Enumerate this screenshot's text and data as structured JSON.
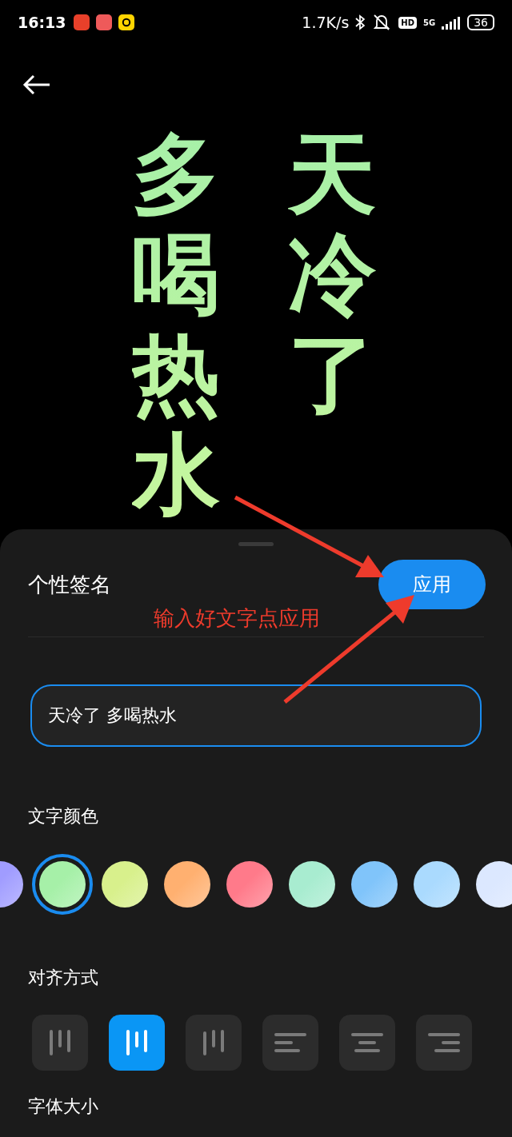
{
  "status_bar": {
    "time": "16:13",
    "speed": "1.7K/s",
    "hd": "HD",
    "network": "5G",
    "battery": "36"
  },
  "signature_preview": {
    "columns": [
      "多喝热水",
      "天冷了"
    ]
  },
  "sheet": {
    "title": "个性签名",
    "apply_button": "应用",
    "annotation": "输入好文字点应用",
    "input": {
      "value": "天冷了 多喝热水"
    },
    "color_label": "文字颜色",
    "colors": [
      {
        "color": "#a09cff",
        "selected": false
      },
      {
        "color": "#a6f0a8",
        "selected": true
      },
      {
        "color": "#d8f08c",
        "selected": false
      },
      {
        "color": "#ffb070",
        "selected": false
      },
      {
        "color": "#ff7a8a",
        "selected": false
      },
      {
        "color": "#a8ecd0",
        "selected": false
      },
      {
        "color": "#80c4fa",
        "selected": false
      },
      {
        "color": "#aadafe",
        "selected": false
      },
      {
        "color": "#dce8ff",
        "selected": false
      }
    ],
    "align_label": "对齐方式",
    "alignments": [
      {
        "kind": "vertical-top",
        "selected": false
      },
      {
        "kind": "vertical-middle",
        "selected": true
      },
      {
        "kind": "vertical-bottom",
        "selected": false
      },
      {
        "kind": "horizontal-left",
        "selected": false
      },
      {
        "kind": "horizontal-center",
        "selected": false
      },
      {
        "kind": "horizontal-right",
        "selected": false
      }
    ],
    "size_label": "字体大小"
  }
}
